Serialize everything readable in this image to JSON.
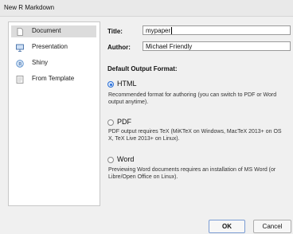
{
  "window": {
    "title": "New R Markdown"
  },
  "sidebar": {
    "items": [
      {
        "label": "Document",
        "icon": "document-icon",
        "selected": true
      },
      {
        "label": "Presentation",
        "icon": "presentation-icon",
        "selected": false
      },
      {
        "label": "Shiny",
        "icon": "shiny-icon",
        "selected": false
      },
      {
        "label": "From Template",
        "icon": "template-icon",
        "selected": false
      }
    ]
  },
  "form": {
    "title_label": "Title:",
    "title_value": "mypaper",
    "author_label": "Author:",
    "author_value": "Michael Friendly",
    "default_format_heading": "Default Output Format:"
  },
  "formats": [
    {
      "label": "HTML",
      "checked": true,
      "description": "Recommended format for authoring (you can switch to PDF or Word output anytime)."
    },
    {
      "label": "PDF",
      "checked": false,
      "description": "PDF output requires TeX (MiKTeX on Windows, MacTeX 2013+ on OS X, TeX Live 2013+ on Linux)."
    },
    {
      "label": "Word",
      "checked": false,
      "description": "Previewing Word documents requires an installation of MS Word (or Libre/Open Office on Linux)."
    }
  ],
  "buttons": {
    "ok": "OK",
    "cancel": "Cancel"
  },
  "colors": {
    "accent": "#2a6fd6",
    "selected_bg": "#dcdcdc"
  }
}
